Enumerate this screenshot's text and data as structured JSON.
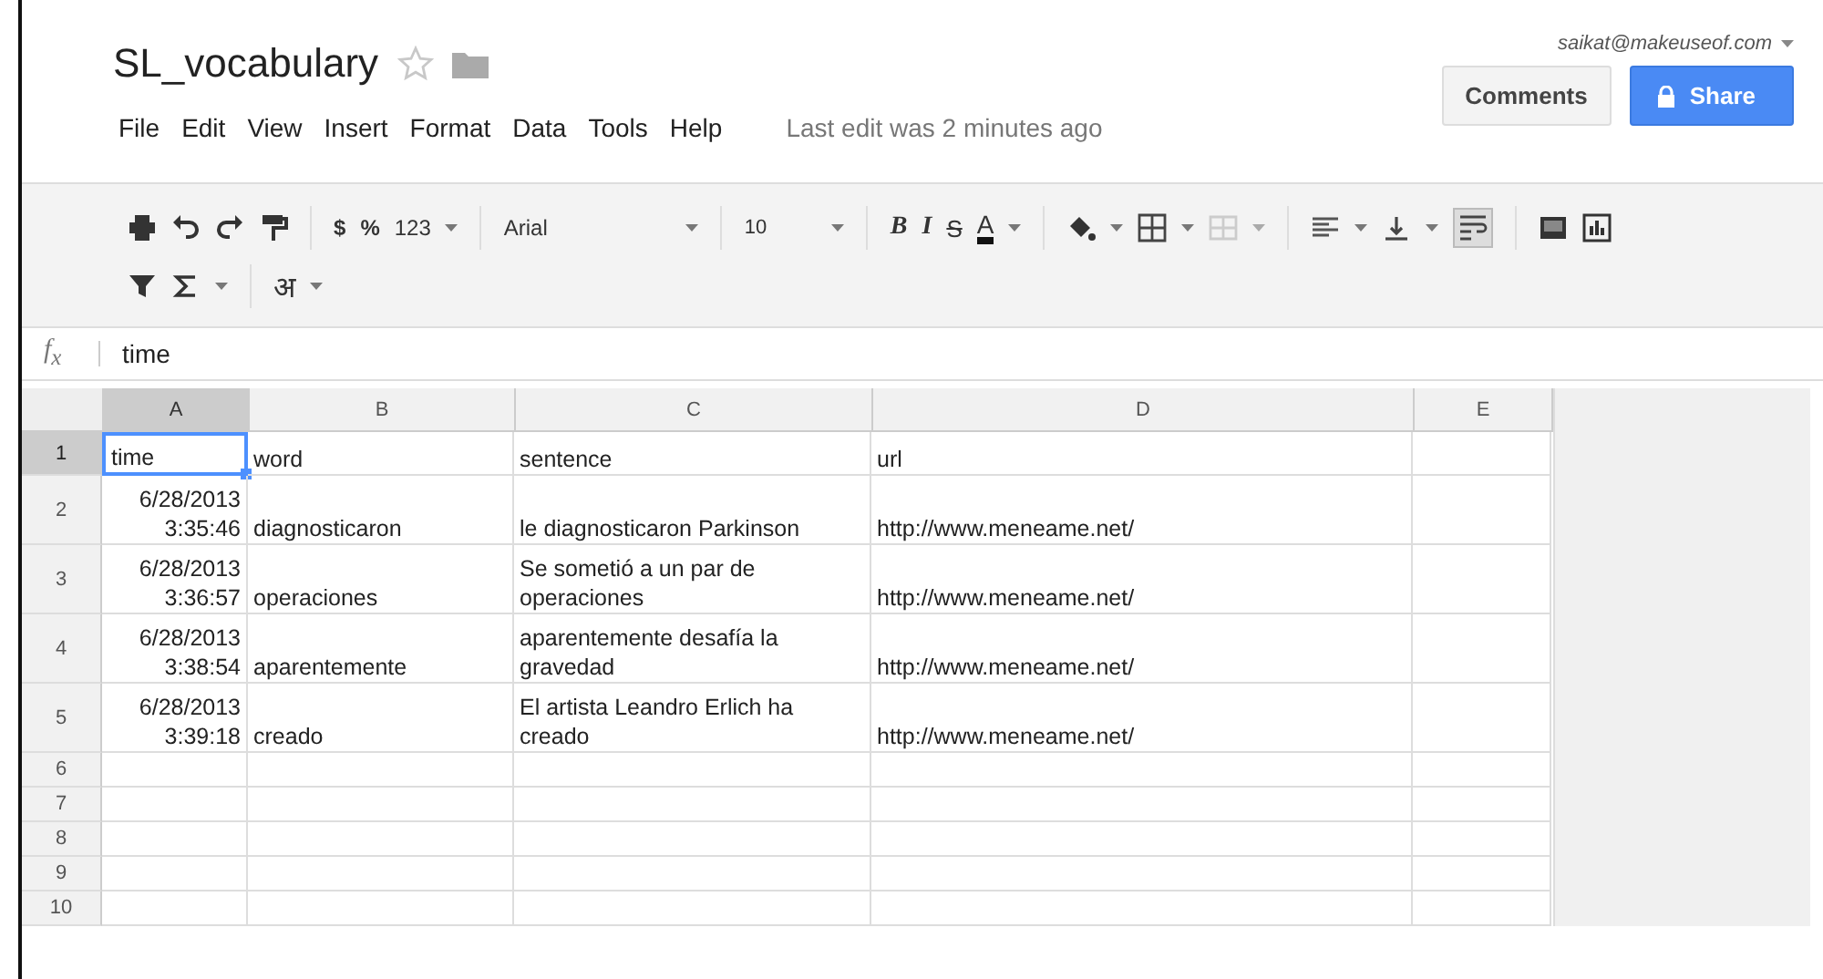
{
  "document": {
    "title": "SL_vocabulary",
    "account": "saikat@makeuseof.com"
  },
  "buttons": {
    "comments": "Comments",
    "share": "Share"
  },
  "menu": [
    {
      "label": "File"
    },
    {
      "label": "Edit"
    },
    {
      "label": "View"
    },
    {
      "label": "Insert"
    },
    {
      "label": "Format"
    },
    {
      "label": "Data"
    },
    {
      "label": "Tools"
    },
    {
      "label": "Help"
    }
  ],
  "last_edit": "Last edit was 2 minutes ago",
  "toolbar": {
    "currency": "$",
    "percent": "%",
    "number_format": "123",
    "font": "Arial",
    "font_size": "10",
    "bold": "B",
    "italic": "I",
    "strikethrough": "S",
    "text_color": "A",
    "input_tools": "अ"
  },
  "formula_bar": {
    "label": "f$_{x}$",
    "value": "time"
  },
  "columns": [
    {
      "label": "A"
    },
    {
      "label": "B"
    },
    {
      "label": "C"
    },
    {
      "label": "D"
    },
    {
      "label": "E"
    }
  ],
  "rows": [
    {
      "number": "1",
      "cells": [
        {
          "text": "time",
          "selected": true
        },
        {
          "text": "word",
          "selected": false
        },
        {
          "text": "sentence",
          "selected": false
        },
        {
          "text": "url",
          "selected": false
        },
        {
          "selected": false
        }
      ]
    },
    {
      "number": "2",
      "cells": [
        {
          "text": "6/28/2013 3:35:46",
          "selected": false
        },
        {
          "text": "diagnosticaron",
          "selected": false
        },
        {
          "text": "le diagnosticaron Parkinson",
          "selected": false
        },
        {
          "text": "http://www.meneame.net/",
          "selected": false
        },
        {
          "selected": false
        }
      ]
    },
    {
      "number": "3",
      "cells": [
        {
          "text": "6/28/2013 3:36:57",
          "selected": false
        },
        {
          "text": "operaciones",
          "selected": false
        },
        {
          "text": "Se sometió a un par de operaciones",
          "selected": false
        },
        {
          "text": "http://www.meneame.net/",
          "selected": false
        },
        {
          "selected": false
        }
      ]
    },
    {
      "number": "4",
      "cells": [
        {
          "text": "6/28/2013 3:38:54",
          "selected": false
        },
        {
          "text": "aparentemente",
          "selected": false
        },
        {
          "text": "aparentemente desafía la gravedad",
          "selected": false
        },
        {
          "text": "http://www.meneame.net/",
          "selected": false
        },
        {
          "selected": false
        }
      ]
    },
    {
      "number": "5",
      "cells": [
        {
          "text": "6/28/2013 3:39:18",
          "selected": false
        },
        {
          "text": "creado",
          "selected": false
        },
        {
          "text": "El artista Leandro Erlich ha creado",
          "selected": false
        },
        {
          "text": "http://www.meneame.net/",
          "selected": false
        },
        {
          "selected": false
        }
      ]
    },
    {
      "number": "6",
      "cells": [
        {
          "selected": false
        },
        {
          "selected": false
        },
        {
          "selected": false
        },
        {
          "selected": false
        },
        {
          "selected": false
        }
      ]
    },
    {
      "number": "7",
      "cells": [
        {
          "selected": false
        },
        {
          "selected": false
        },
        {
          "selected": false
        },
        {
          "selected": false
        },
        {
          "selected": false
        }
      ]
    },
    {
      "number": "8",
      "cells": [
        {
          "selected": false
        },
        {
          "selected": false
        },
        {
          "selected": false
        },
        {
          "selected": false
        },
        {
          "selected": false
        }
      ]
    },
    {
      "number": "9",
      "cells": [
        {
          "selected": false
        },
        {
          "selected": false
        },
        {
          "selected": false
        },
        {
          "selected": false
        },
        {
          "selected": false
        }
      ]
    },
    {
      "number": "10",
      "cells": [
        {
          "selected": false
        },
        {
          "selected": false
        },
        {
          "selected": false
        },
        {
          "selected": false
        },
        {
          "selected": false
        }
      ]
    }
  ]
}
